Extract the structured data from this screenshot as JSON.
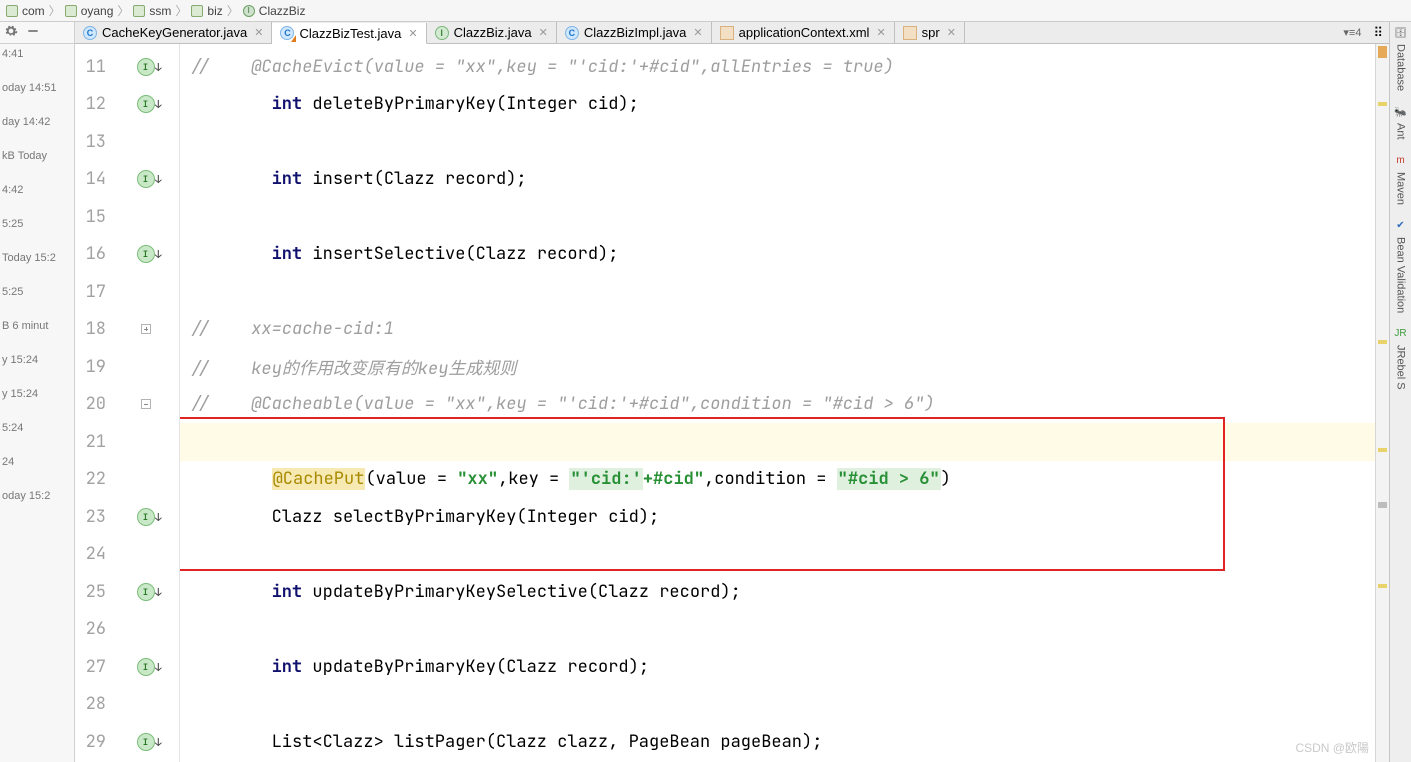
{
  "breadcrumb": {
    "items": [
      "com",
      "oyang",
      "ssm",
      "biz",
      "ClazzBiz"
    ]
  },
  "left": {
    "history": [
      "4:41",
      "oday 14:51",
      "day 14:42",
      "kB Today",
      "4:42",
      "5:25",
      "Today 15:2",
      "5:25",
      "B 6 minut",
      "y 15:24",
      "y 15:24",
      "5:24",
      "24",
      "oday 15:2"
    ]
  },
  "tabs": {
    "items": [
      {
        "label": "CacheKeyGenerator.java",
        "icon": "c"
      },
      {
        "label": "ClazzBizTest.java",
        "icon": "ctest",
        "active": true
      },
      {
        "label": "ClazzBiz.java",
        "icon": "i"
      },
      {
        "label": "ClazzBizImpl.java",
        "icon": "c"
      },
      {
        "label": "applicationContext.xml",
        "icon": "x"
      },
      {
        "label": "spr",
        "icon": "x"
      }
    ],
    "more": "▾≡4"
  },
  "right_tools": [
    "Database",
    "Ant",
    "Maven",
    "Bean Validation",
    "JRebel S"
  ],
  "editor": {
    "first_line_no": 11,
    "lines": [
      {
        "n": 11,
        "mark": "impl",
        "tokens": [
          {
            "t": "//    ",
            "c": "cmt"
          },
          {
            "t": "@CacheEvict(value = \"xx\",key = \"'cid:'+#cid\",allEntries = true)",
            "c": "cmt"
          }
        ],
        "cutoff": true
      },
      {
        "n": 12,
        "mark": "impl",
        "tokens": [
          {
            "t": "        "
          },
          {
            "t": "int",
            "c": "kw"
          },
          {
            "t": " deleteByPrimaryKey(Integer cid);"
          }
        ]
      },
      {
        "n": 13,
        "tokens": []
      },
      {
        "n": 14,
        "mark": "impl",
        "tokens": [
          {
            "t": "        "
          },
          {
            "t": "int",
            "c": "kw"
          },
          {
            "t": " insert(Clazz record);"
          }
        ]
      },
      {
        "n": 15,
        "tokens": []
      },
      {
        "n": 16,
        "mark": "impl",
        "tokens": [
          {
            "t": "        "
          },
          {
            "t": "int",
            "c": "kw"
          },
          {
            "t": " insertSelective(Clazz record);"
          }
        ]
      },
      {
        "n": 17,
        "tokens": []
      },
      {
        "n": 18,
        "fold": "open",
        "tokens": [
          {
            "t": "//    xx=cache-cid:1",
            "c": "cmt"
          }
        ]
      },
      {
        "n": 19,
        "tokens": [
          {
            "t": "//    key的作用改变原有的key生成规则",
            "c": "cmt"
          }
        ]
      },
      {
        "n": 20,
        "fold": "close",
        "tokens": [
          {
            "t": "//    @Cacheable(value = \"xx\",key = \"'cid:'+#cid\",condition = \"#cid > 6\")",
            "c": "cmt"
          }
        ]
      },
      {
        "n": 21,
        "current": true,
        "tokens": []
      },
      {
        "n": 22,
        "tokens": [
          {
            "t": "        "
          },
          {
            "t": "@CachePut",
            "c": "ann-y"
          },
          {
            "t": "(value = "
          },
          {
            "t": "\"xx\"",
            "c": "str"
          },
          {
            "t": ",key = "
          },
          {
            "t": "\"'cid:'",
            "c": "str-hl"
          },
          {
            "t": "+#cid\"",
            "c": "str"
          },
          {
            "t": ",condition = "
          },
          {
            "t": "\"#cid > 6\"",
            "c": "str-hl"
          },
          {
            "t": ")"
          }
        ]
      },
      {
        "n": 23,
        "mark": "impl",
        "tokens": [
          {
            "t": "        Clazz selectByPrimaryKey(Integer cid);"
          }
        ]
      },
      {
        "n": 24,
        "tokens": []
      },
      {
        "n": 25,
        "mark": "impl",
        "tokens": [
          {
            "t": "        "
          },
          {
            "t": "int",
            "c": "kw"
          },
          {
            "t": " updateByPrimaryKeySelective(Clazz record);"
          }
        ]
      },
      {
        "n": 26,
        "tokens": []
      },
      {
        "n": 27,
        "mark": "impl",
        "tokens": [
          {
            "t": "        "
          },
          {
            "t": "int",
            "c": "kw"
          },
          {
            "t": " updateByPrimaryKey(Clazz record);"
          }
        ]
      },
      {
        "n": 28,
        "tokens": []
      },
      {
        "n": 29,
        "mark": "impl",
        "tokens": [
          {
            "t": "        List<Clazz> listPager(Clazz clazz, PageBean pageBean);"
          }
        ]
      }
    ]
  },
  "watermark": "CSDN @欧陽"
}
